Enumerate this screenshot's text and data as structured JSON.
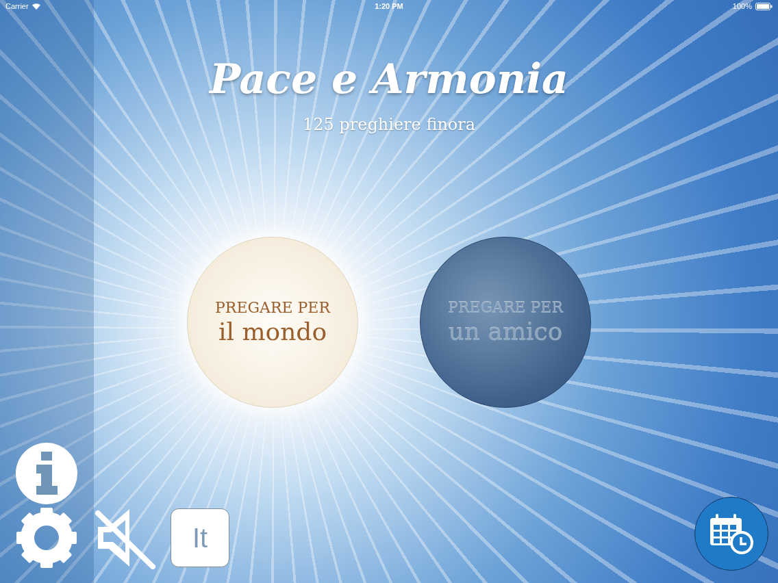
{
  "status_bar": {
    "carrier": "Carrier",
    "time": "1:20 PM",
    "battery": "100%"
  },
  "title": "Pace e Armonia",
  "prayer_count": "125 preghiere finora",
  "prayer_buttons": [
    {
      "caption": "PREGARE PER",
      "target": "il mondo",
      "selected": true
    },
    {
      "caption": "PREGARE PER",
      "target": "un amico",
      "selected": false
    }
  ],
  "language_button": "It"
}
